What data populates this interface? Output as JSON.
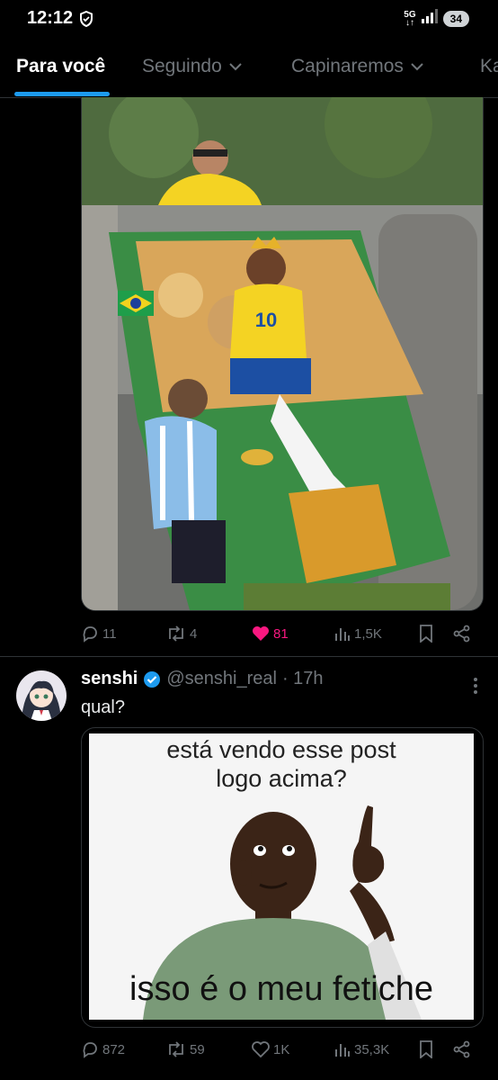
{
  "status_bar": {
    "time": "12:12",
    "network": "5G",
    "battery": "34"
  },
  "tabs": [
    {
      "label": "Para você",
      "active": true
    },
    {
      "label": "Seguindo"
    },
    {
      "label": "Capinaremos"
    },
    {
      "label": "Ka"
    }
  ],
  "post1": {
    "image_icon": "blanket-artwork-photo",
    "shirt_number": "10",
    "replies": "11",
    "reposts": "4",
    "likes": "81",
    "views": "1,5K"
  },
  "post2": {
    "author_name": "senshi",
    "handle": "@senshi_real",
    "time": "· 17h",
    "text": "qual?",
    "meme_top_text": "está vendo esse post logo acima?",
    "meme_bottom_text": "isso é o meu fetiche",
    "replies": "872",
    "reposts": "59",
    "likes": "1K",
    "views": "35,3K"
  },
  "colors": {
    "accent": "#1d9bf0",
    "like": "#f91880",
    "muted": "#71767b",
    "divider": "#2f3336"
  }
}
